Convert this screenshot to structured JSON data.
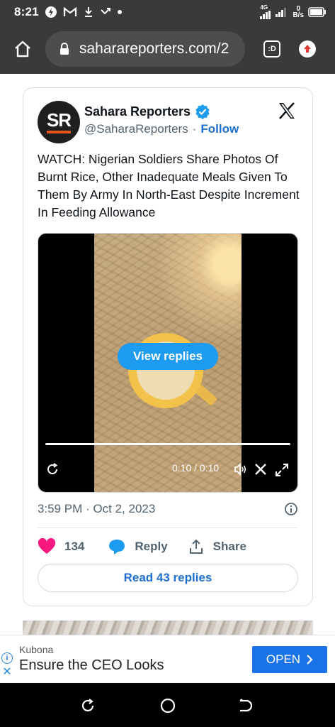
{
  "status_bar": {
    "time": "8:21",
    "net_speed_value": "0",
    "net_speed_unit": "B/s",
    "network_type": "4G",
    "icons": [
      "data-saver-icon",
      "gmail-icon",
      "download-icon",
      "missed-call-icon",
      "dot-icon",
      "signal-icon",
      "signal-icon-2",
      "battery-icon"
    ]
  },
  "browser": {
    "url": "saharareporters.com/2",
    "tabs_label": ":D",
    "icons": [
      "home-icon",
      "lock-icon",
      "update-icon"
    ]
  },
  "tweet": {
    "avatar_text": "SR",
    "author_name": "Sahara Reporters",
    "handle": "@SaharaReporters",
    "separator": "·",
    "follow_label": "Follow",
    "text": "WATCH: Nigerian Soldiers Share Photos Of Burnt Rice, Other Inadequate Meals Given To Them By Army In North-East Despite Increment In Feeding Allowance",
    "video": {
      "view_replies_label": "View replies",
      "time": "0:10 / 0:10",
      "progress": 1.0
    },
    "timestamp": "3:59 PM · Oct 2, 2023",
    "likes": "134",
    "reply_label": "Reply",
    "share_label": "Share",
    "read_replies_label": "Read 43 replies",
    "colors": {
      "like": "#f91880",
      "link": "#1d6fd1",
      "verified": "#1d9bf0"
    }
  },
  "ad": {
    "brand": "Kubona",
    "title": "Ensure the CEO Looks",
    "open_label": "OPEN",
    "color": "#1a73e8"
  },
  "nav": {
    "icons": [
      "recent-apps-icon",
      "home-circle-icon",
      "back-icon"
    ]
  }
}
